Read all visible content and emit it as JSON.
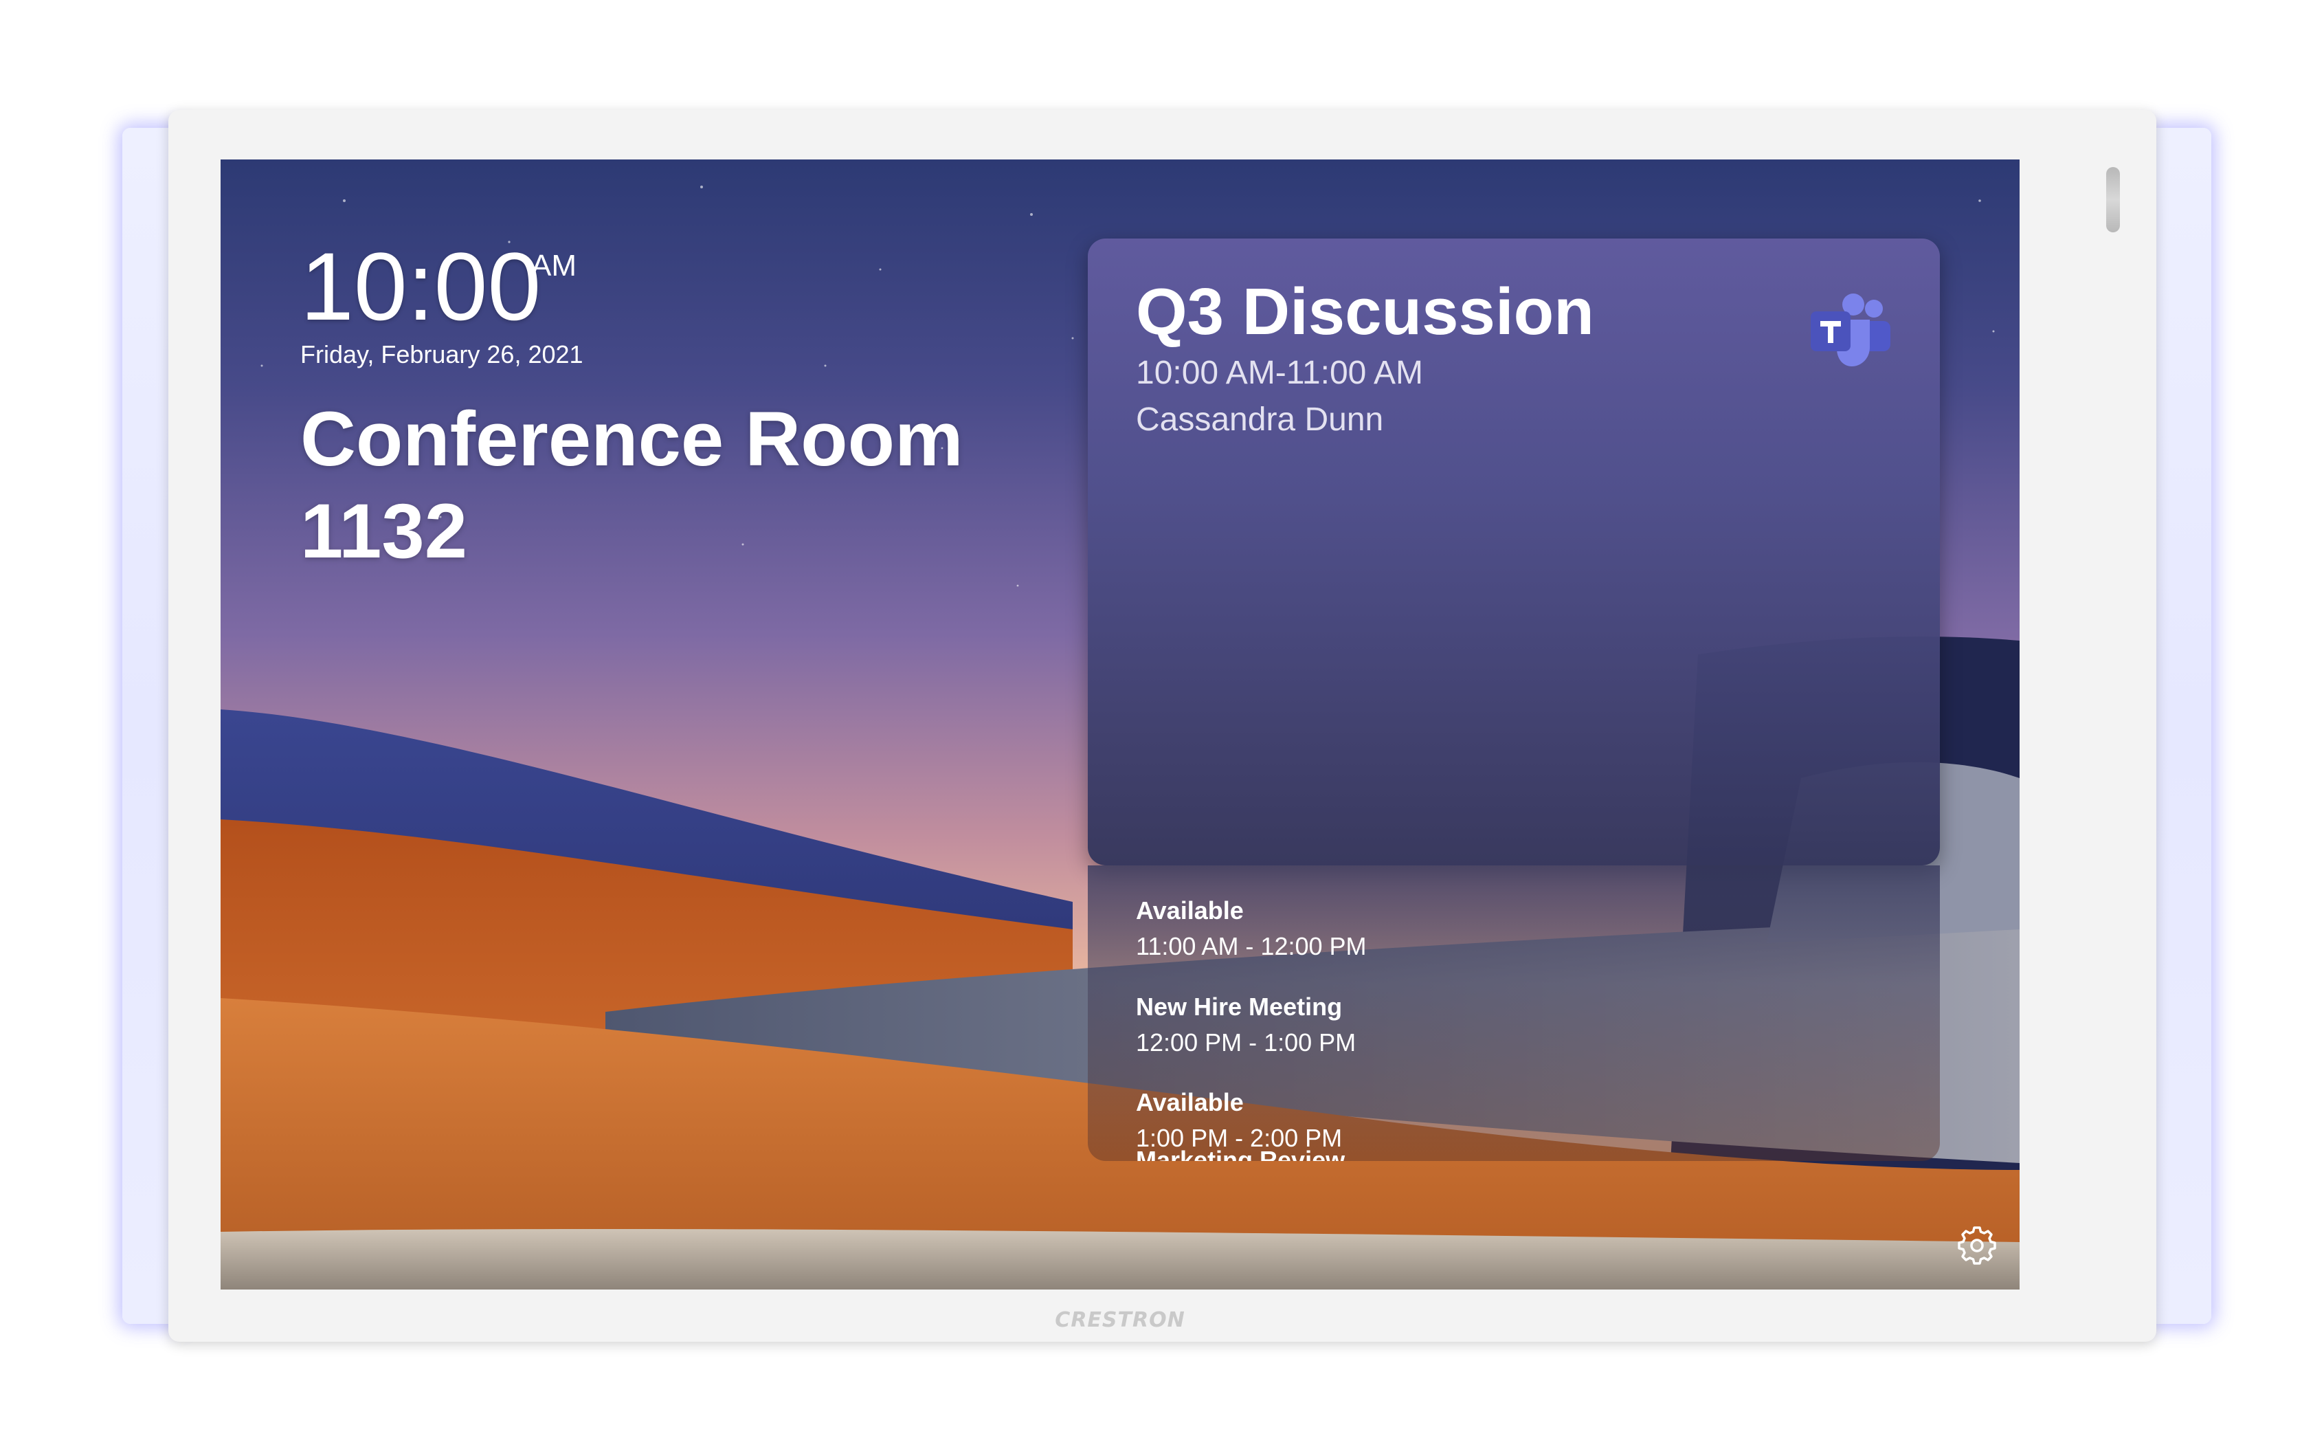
{
  "clock": {
    "time": "10:00",
    "ampm": "AM",
    "date": "Friday, February 26, 2021"
  },
  "room": {
    "name_line1": "Conference Room",
    "name_line2": "1132"
  },
  "current_meeting": {
    "title": "Q3 Discussion",
    "time": "10:00 AM-11:00 AM",
    "organizer": "Cassandra Dunn",
    "icon": "microsoft-teams-icon"
  },
  "schedule": [
    {
      "title": "Available",
      "time": "11:00 AM - 12:00 PM"
    },
    {
      "title": "New Hire Meeting",
      "time": "12:00 PM - 1:00 PM"
    },
    {
      "title": "Available",
      "time": "1:00 PM - 2:00 PM"
    },
    {
      "title": "Marketing Review",
      "time": ""
    }
  ],
  "device": {
    "brand": "CRESTRON"
  },
  "settings": {
    "icon": "gear-icon"
  },
  "colors": {
    "teams_purple": "#5b5fc7",
    "card_top": "#625ca0",
    "card_bottom": "#34365c"
  }
}
